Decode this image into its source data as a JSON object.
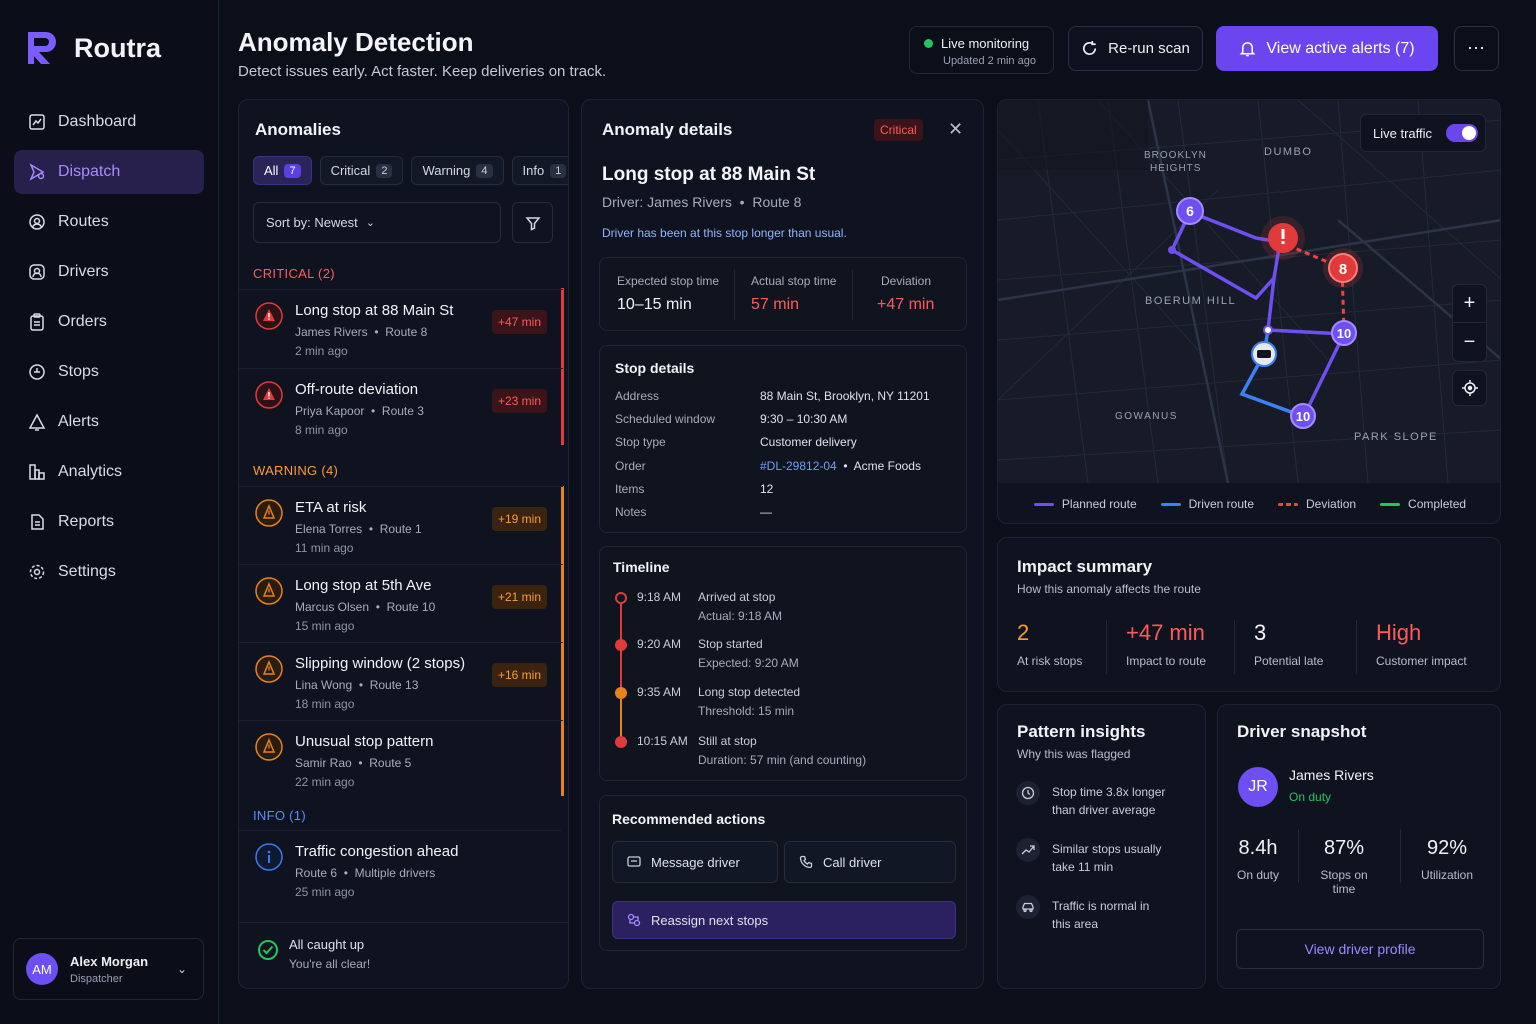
{
  "brand": {
    "name": "Routra"
  },
  "nav": [
    {
      "label": "Dashboard",
      "icon": "dashboard-icon"
    },
    {
      "label": "Dispatch",
      "icon": "dispatch-icon",
      "active": true
    },
    {
      "label": "Routes",
      "icon": "routes-icon"
    },
    {
      "label": "Drivers",
      "icon": "drivers-icon"
    },
    {
      "label": "Orders",
      "icon": "orders-icon"
    },
    {
      "label": "Stops",
      "icon": "stops-icon"
    },
    {
      "label": "Alerts",
      "icon": "alerts-icon"
    },
    {
      "label": "Analytics",
      "icon": "analytics-icon"
    },
    {
      "label": "Reports",
      "icon": "reports-icon"
    },
    {
      "label": "Settings",
      "icon": "settings-icon"
    }
  ],
  "user": {
    "initials": "AM",
    "name": "Alex Morgan",
    "role": "Dispatcher"
  },
  "header": {
    "title": "Anomaly Detection",
    "subtitle": "Detect issues early. Act faster. Keep deliveries on track.",
    "live_title": "Live monitoring",
    "live_updated": "Updated 2 min ago",
    "rerun": "Re-run scan",
    "alerts": "View active alerts (7)"
  },
  "anomalies": {
    "title": "Anomalies",
    "chips": [
      {
        "label": "All",
        "count": "7"
      },
      {
        "label": "Critical",
        "count": "2"
      },
      {
        "label": "Warning",
        "count": "4"
      },
      {
        "label": "Info",
        "count": "1"
      }
    ],
    "sort": "Sort by: Newest",
    "critical_label": "CRITICAL (2)",
    "warning_label": "WARNING (4)",
    "info_label": "INFO (1)",
    "critical": [
      {
        "title": "Long stop at 88 Main St",
        "driver": "James Rivers",
        "route": "Route 8",
        "ago": "2 min ago",
        "delta": "+47 min"
      },
      {
        "title": "Off-route deviation",
        "driver": "Priya Kapoor",
        "route": "Route 3",
        "ago": "8 min ago",
        "delta": "+23 min"
      }
    ],
    "warning": [
      {
        "title": "ETA at risk",
        "driver": "Elena Torres",
        "route": "Route 1",
        "ago": "11 min ago",
        "delta": "+19 min"
      },
      {
        "title": "Long stop at 5th Ave",
        "driver": "Marcus Olsen",
        "route": "Route 10",
        "ago": "15 min ago",
        "delta": "+21 min"
      },
      {
        "title": "Slipping window (2 stops)",
        "driver": "Lina Wong",
        "route": "Route 13",
        "ago": "18 min ago",
        "delta": "+16 min"
      },
      {
        "title": "Unusual stop pattern",
        "driver": "Samir Rao",
        "route": "Route 5",
        "ago": "22 min ago",
        "delta": ""
      }
    ],
    "info": [
      {
        "title": "Traffic congestion ahead",
        "driver": "Route 6",
        "route": "Multiple drivers",
        "ago": "25 min ago"
      }
    ],
    "caught_title": "All caught up",
    "caught_sub": "You're all clear!"
  },
  "details": {
    "title": "Anomaly details",
    "tag": "Critical",
    "heading": "Long stop at 88 Main St",
    "driver_line": "Driver: James Rivers",
    "route_line": "Route 8",
    "note": "Driver has been at this stop longer than usual.",
    "stats": [
      {
        "label": "Expected stop time",
        "value": "10–15 min"
      },
      {
        "label": "Actual stop time",
        "value": "57 min"
      },
      {
        "label": "Deviation",
        "value": "+47 min"
      }
    ],
    "stop_title": "Stop details",
    "stop": [
      {
        "k": "Address",
        "v": "88 Main St, Brooklyn, NY 11201"
      },
      {
        "k": "Scheduled window",
        "v": "9:30 – 10:30 AM"
      },
      {
        "k": "Stop type",
        "v": "Customer delivery"
      },
      {
        "k": "Order",
        "v": "Acme Foods",
        "link": "#DL-29812-04"
      },
      {
        "k": "Items",
        "v": "12"
      },
      {
        "k": "Notes",
        "v": "—"
      }
    ],
    "timeline_title": "Timeline",
    "timeline": [
      {
        "time": "9:18 AM",
        "title": "Arrived at stop",
        "sub": "Actual: 9:18 AM"
      },
      {
        "time": "9:20 AM",
        "title": "Stop started",
        "sub": "Expected: 9:20 AM"
      },
      {
        "time": "9:35 AM",
        "title": "Long stop detected",
        "sub": "Threshold: 15 min"
      },
      {
        "time": "10:15 AM",
        "title": "Still at stop",
        "sub": "Duration: 57 min (and counting)"
      }
    ],
    "actions_title": "Recommended actions",
    "message": "Message driver",
    "call": "Call driver",
    "reassign": "Reassign next stops"
  },
  "map": {
    "live_traffic": "Live traffic",
    "places": [
      "BROOKLYN",
      "HEIGHTS",
      "DUMBO",
      "BOERUM HILL",
      "GOWANUS",
      "PARK SLOPE"
    ],
    "markers": [
      "6",
      "8",
      "10",
      "10"
    ],
    "legend": [
      "Planned route",
      "Driven route",
      "Deviation",
      "Completed"
    ],
    "colors": {
      "planned": "#6d4ff2",
      "driven": "#3b82f6",
      "deviation": "#ef4444",
      "completed": "#22c55e"
    }
  },
  "impact": {
    "title": "Impact summary",
    "subtitle": "How this anomaly affects the route",
    "items": [
      {
        "value": "2",
        "label": "At risk stops"
      },
      {
        "value": "+47 min",
        "label": "Impact to route"
      },
      {
        "value": "3",
        "label": "Potential late"
      },
      {
        "value": "High",
        "label": "Customer impact"
      }
    ]
  },
  "pattern": {
    "title": "Pattern insights",
    "subtitle": "Why this was flagged",
    "items": [
      {
        "l1": "Stop time 3.8x longer",
        "l2": "than driver average"
      },
      {
        "l1": "Similar stops usually",
        "l2": "take 11 min"
      },
      {
        "l1": "Traffic is normal in",
        "l2": "this area"
      }
    ]
  },
  "driver": {
    "title": "Driver snapshot",
    "initials": "JR",
    "name": "James Rivers",
    "status": "On duty",
    "stats": [
      {
        "value": "8.4h",
        "label": "On duty"
      },
      {
        "value": "87%",
        "label": "Stops on time"
      },
      {
        "value": "92%",
        "label": "Utilization"
      }
    ],
    "view": "View driver profile"
  }
}
